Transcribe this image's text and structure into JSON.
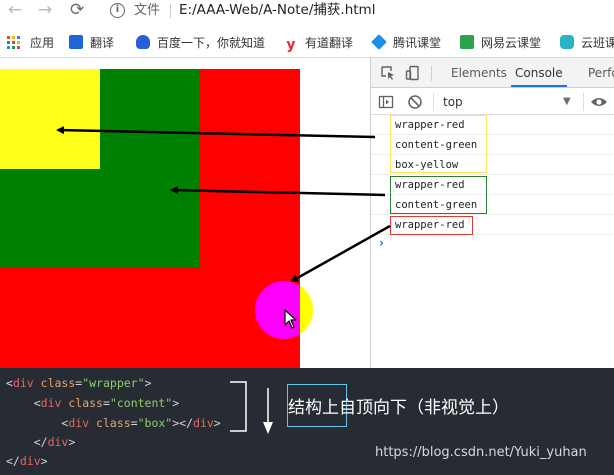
{
  "browser": {
    "back_glyph": "←",
    "forward_glyph": "→",
    "reload_glyph": "⟳",
    "info_glyph": "i",
    "file_label": "文件",
    "url": "E:/AAA-Web/A-Note/捕获.html"
  },
  "bookmarks": [
    {
      "label": "应用",
      "icon": "apps-grid-icon"
    },
    {
      "label": "翻译",
      "icon": "translate-icon",
      "color": "#1e66d6"
    },
    {
      "label": "百度一下，你就知道",
      "icon": "baidu-paw-icon",
      "color": "#2b5fd9"
    },
    {
      "label": "有道翻译",
      "icon": "youdao-icon",
      "color": "#e8262d",
      "glyph": "y"
    },
    {
      "label": "腾讯课堂",
      "icon": "tencent-class-icon",
      "color": "#1f8fe6"
    },
    {
      "label": "网易云课堂",
      "icon": "netease-class-icon",
      "color": "#2aa44a"
    },
    {
      "label": "云班课",
      "icon": "cloud-class-icon",
      "color": "#27b4c5"
    }
  ],
  "page": {
    "colors": {
      "wrapper": "#ff0000",
      "content": "#008000",
      "box": "#ffff1a",
      "ball_left": "#ff00ff",
      "ball_right": "#ffff00"
    }
  },
  "devtools": {
    "tabs": [
      "Elements",
      "Console",
      "Perfo"
    ],
    "active_tab": "Console",
    "context": "top",
    "prompt_glyph": "›",
    "log_groups": [
      {
        "lines": [
          "wrapper-red",
          "content-green",
          "box-yellow"
        ],
        "outline_color": "#ffe25a"
      },
      {
        "lines": [
          "wrapper-red",
          "content-green"
        ],
        "outline_color": "#2e7d32"
      },
      {
        "lines": [
          "wrapper-red"
        ],
        "outline_color": "#e53935"
      }
    ]
  },
  "code": {
    "lines": [
      {
        "indent": "",
        "open": "<",
        "tag": "div",
        "attr": "class",
        "value": "\"wrapper\"",
        "close": ">",
        "end_tag": ""
      },
      {
        "indent": "    ",
        "open": "<",
        "tag": "div",
        "attr": "class",
        "value": "\"content\"",
        "close": ">",
        "end_tag": ""
      },
      {
        "indent": "        ",
        "open": "<",
        "tag": "div",
        "attr": "class",
        "value": "\"box\"",
        "close": "></",
        "end_tag": "div"
      },
      {
        "indent": "    ",
        "open": "</",
        "tag": "div",
        "attr": "",
        "value": "",
        "close": ">",
        "end_tag": ""
      },
      {
        "indent": "",
        "open": "</",
        "tag": "div",
        "attr": "",
        "value": "",
        "close": ">",
        "end_tag": ""
      }
    ],
    "caption": "结构上自顶向下（非视觉上）",
    "watermark": "https://blog.csdn.net/Yuki_yuhan"
  }
}
